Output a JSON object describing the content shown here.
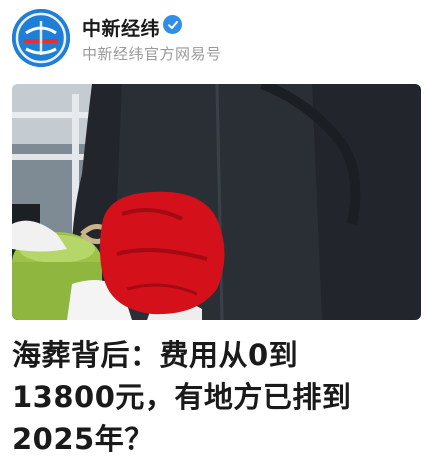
{
  "account": {
    "name": "中新经纬",
    "subtitle": "中新经纬官方网易号",
    "avatar_icon": "zhongxin-jingwei-logo-icon",
    "verified_icon": "verified-check-icon",
    "brand_color": "#1f7fd6"
  },
  "media": {
    "type": "photo"
  },
  "article": {
    "title_line1": "海葬背后：费用从0到",
    "title_line2": "13800元，有地方已排到",
    "title_line3": "2025年？"
  }
}
